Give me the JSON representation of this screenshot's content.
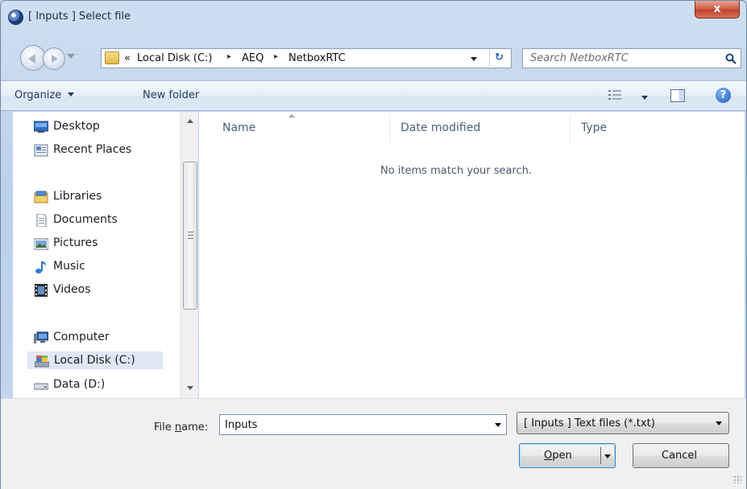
{
  "window": {
    "title": "[ Inputs ] Select file",
    "close_label": "x"
  },
  "address": {
    "overflow": "«",
    "crumbs": [
      "Local Disk (C:)",
      "AEQ",
      "NetboxRTC"
    ],
    "separator": "▸",
    "refresh_glyph": "↻"
  },
  "search": {
    "placeholder": "Search NetboxRTC"
  },
  "toolbar": {
    "organize_label": "Organize",
    "new_folder_label": "New folder",
    "help_glyph": "?"
  },
  "nav": {
    "items": [
      {
        "label": "Desktop",
        "icon": "desktop-icon"
      },
      {
        "label": "Recent Places",
        "icon": "recent-places-icon"
      },
      {
        "label": "Libraries",
        "icon": "libraries-icon"
      },
      {
        "label": "Documents",
        "icon": "documents-icon"
      },
      {
        "label": "Pictures",
        "icon": "pictures-icon"
      },
      {
        "label": "Music",
        "icon": "music-icon"
      },
      {
        "label": "Videos",
        "icon": "videos-icon"
      },
      {
        "label": "Computer",
        "icon": "computer-icon"
      },
      {
        "label": "Local Disk (C:)",
        "icon": "local-disk-icon",
        "selected": true
      },
      {
        "label": "Data (D:)",
        "icon": "drive-icon"
      }
    ]
  },
  "files": {
    "columns": [
      "Name",
      "Date modified",
      "Type"
    ],
    "sorted_by": "Name",
    "empty_message": "No items match your search."
  },
  "footer": {
    "file_name_label_pre": "File ",
    "file_name_label_accel": "n",
    "file_name_label_post": "ame:",
    "file_name_value": "Inputs",
    "filter_value": "[ Inputs ] Text files (*.txt)",
    "open_accel": "O",
    "open_rest": "pen",
    "cancel_label": "Cancel"
  },
  "colors": {
    "accent": "#3c7fb1",
    "selection": "#dfe8f6",
    "header_text": "#4c607a"
  }
}
